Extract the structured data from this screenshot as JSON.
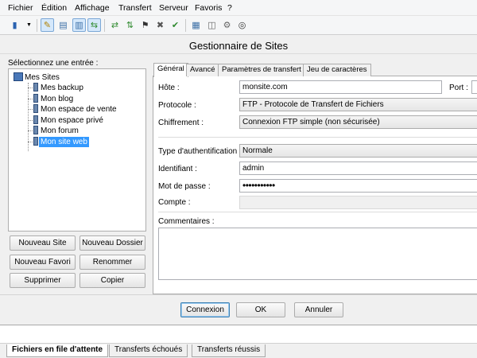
{
  "menu": [
    "Fichier",
    "Édition",
    "Affichage",
    "Transfert",
    "Serveur",
    "Favoris",
    "?"
  ],
  "dialog": {
    "title": "Gestionnaire de Sites",
    "select_label": "Sélectionnez une entrée :",
    "tree": {
      "root": "Mes Sites",
      "items": [
        "Mes backup",
        "Mon blog",
        "Mon espace de vente",
        "Mon espace privé",
        "Mon forum",
        "Mon site web"
      ],
      "selected": "Mon site web"
    },
    "buttons": {
      "new_site": "Nouveau Site",
      "new_folder": "Nouveau Dossier",
      "new_bookmark": "Nouveau Favori",
      "rename": "Renommer",
      "delete": "Supprimer",
      "copy": "Copier",
      "connect": "Connexion",
      "ok": "OK",
      "cancel": "Annuler"
    },
    "tabs": [
      "Général",
      "Avancé",
      "Paramètres de transfert",
      "Jeu de caractères"
    ],
    "active_tab": "Général",
    "form": {
      "host_label": "Hôte :",
      "host_value": "monsite.com",
      "port_label": "Port :",
      "protocol_label": "Protocole :",
      "protocol_value": "FTP - Protocole de Transfert de Fichiers",
      "encryption_label": "Chiffrement :",
      "encryption_value": "Connexion FTP simple (non sécurisée)",
      "auth_label": "Type d'authentification :",
      "auth_value": "Normale",
      "user_label": "Identifiant :",
      "user_value": "admin",
      "password_label": "Mot de passe :",
      "password_value": "•••••••••••",
      "account_label": "Compte :",
      "comments_label": "Commentaires :"
    }
  },
  "queue_tabs": [
    "Fichiers en file d'attente",
    "Transferts échoués",
    "Transferts réussis"
  ],
  "colors": {
    "selection": "#3399ff"
  }
}
